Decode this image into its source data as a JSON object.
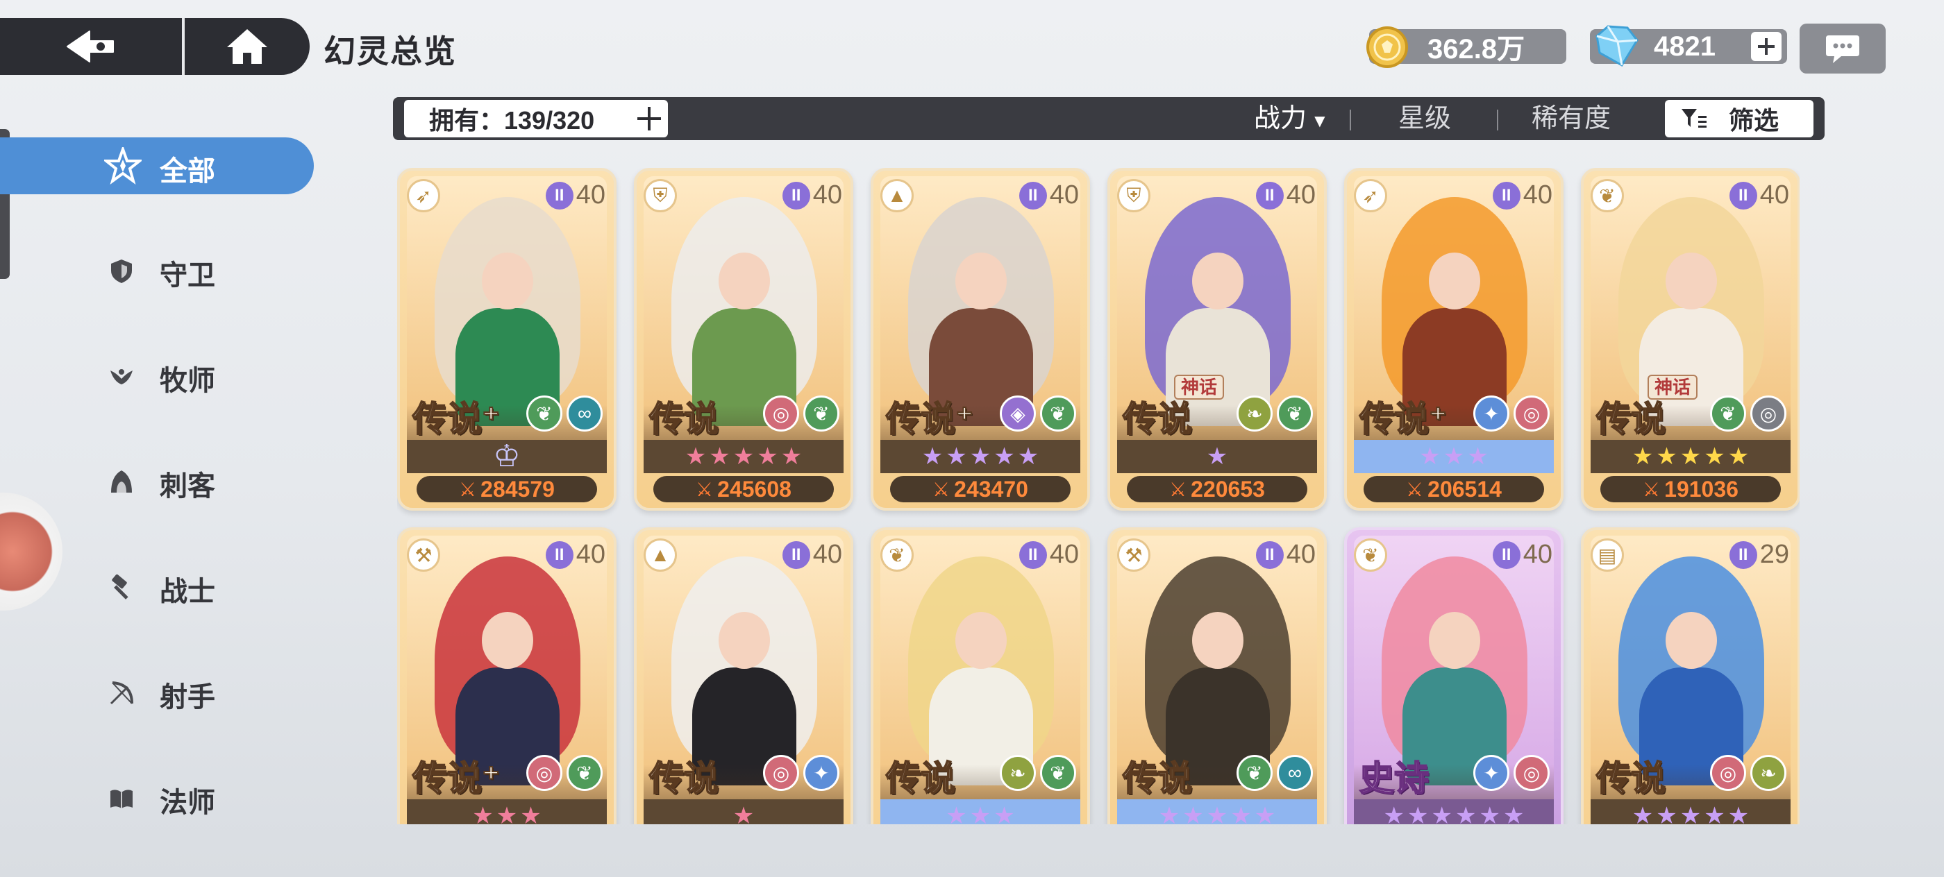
{
  "header": {
    "title": "幻灵总览",
    "gold": "362.8万",
    "gems": "4821"
  },
  "filter": {
    "owned_label": "拥有：139/320",
    "sort_power": "战力",
    "sort_star": "星级",
    "sort_rarity": "稀有度",
    "filter_label": "筛选"
  },
  "sidebar": {
    "items": [
      {
        "label": "全部",
        "icon": "all-star-icon"
      },
      {
        "label": "守卫",
        "icon": "shield-icon"
      },
      {
        "label": "牧师",
        "icon": "wing-icon"
      },
      {
        "label": "刺客",
        "icon": "hood-icon"
      },
      {
        "label": "战士",
        "icon": "hammer-icon"
      },
      {
        "label": "射手",
        "icon": "bow-icon"
      },
      {
        "label": "法师",
        "icon": "book-icon"
      }
    ]
  },
  "cards": [
    {
      "rarity": "传说",
      "plus": true,
      "myth": "",
      "level": "40",
      "class": "bow",
      "elements": [
        "green",
        "teal"
      ],
      "stars": "crown",
      "starcolor": "",
      "band": "dark",
      "power": "284579",
      "hair": "#e8dccd",
      "body": "#2d8a53"
    },
    {
      "rarity": "传说",
      "plus": false,
      "myth": "",
      "level": "40",
      "class": "shield",
      "elements": [
        "pink",
        "green"
      ],
      "stars": 5,
      "starcolor": "pink",
      "band": "dark",
      "power": "245608",
      "hair": "#ececec",
      "body": "#6c9a4f"
    },
    {
      "rarity": "传说",
      "plus": true,
      "myth": "",
      "level": "40",
      "class": "hood",
      "elements": [
        "purple",
        "green"
      ],
      "stars": 5,
      "starcolor": "purple",
      "band": "dark",
      "power": "243470",
      "hair": "#d9d4cf",
      "body": "#7a4b3a"
    },
    {
      "rarity": "传说",
      "plus": false,
      "myth": "神话",
      "level": "40",
      "class": "shield",
      "elements": [
        "olive",
        "green"
      ],
      "stars": 1,
      "starcolor": "purple",
      "band": "dark",
      "power": "220653",
      "hair": "#7b6ad0",
      "body": "#e9e3d7"
    },
    {
      "rarity": "传说",
      "plus": true,
      "myth": "",
      "level": "40",
      "class": "bow",
      "elements": [
        "blue",
        "pink"
      ],
      "stars": 3,
      "starcolor": "purple",
      "band": "blue",
      "power": "206514",
      "hair": "#f39a2b",
      "body": "#8c3b24"
    },
    {
      "rarity": "传说",
      "plus": false,
      "myth": "神话",
      "level": "40",
      "class": "wing",
      "elements": [
        "green",
        "gray"
      ],
      "stars": 5,
      "starcolor": "gold",
      "band": "dark",
      "power": "191036",
      "hair": "#f2d69a",
      "body": "#f3ece2"
    },
    {
      "rarity": "传说",
      "plus": true,
      "myth": "",
      "level": "40",
      "class": "hammer",
      "elements": [
        "pink",
        "green"
      ],
      "stars": 3,
      "starcolor": "pink",
      "band": "dark",
      "power": "",
      "hair": "#c9343c",
      "body": "#2c2f4d"
    },
    {
      "rarity": "传说",
      "plus": false,
      "myth": "",
      "level": "40",
      "class": "hood",
      "elements": [
        "pink",
        "blue"
      ],
      "stars": 1,
      "starcolor": "pink",
      "band": "dark",
      "power": "",
      "hair": "#eeeeee",
      "body": "#252428"
    },
    {
      "rarity": "传说",
      "plus": false,
      "myth": "",
      "level": "40",
      "class": "wing",
      "elements": [
        "olive",
        "green"
      ],
      "stars": 3,
      "starcolor": "purple",
      "band": "blue",
      "power": "",
      "hair": "#f0d68a",
      "body": "#f2efe6"
    },
    {
      "rarity": "传说",
      "plus": false,
      "myth": "",
      "level": "40",
      "class": "hammer",
      "elements": [
        "green",
        "teal"
      ],
      "stars": 5,
      "starcolor": "purple",
      "band": "blue",
      "power": "",
      "hair": "#4c4030",
      "body": "#3b332a"
    },
    {
      "rarity": "史诗",
      "plus": false,
      "myth": "",
      "level": "40",
      "class": "wing",
      "elements": [
        "blue",
        "pink"
      ],
      "stars": 6,
      "starcolor": "purple",
      "band": "purple",
      "power": "",
      "hair": "#f08aa0",
      "body": "#3d8e8c",
      "epic": true
    },
    {
      "rarity": "传说",
      "plus": false,
      "myth": "",
      "level": "29",
      "class": "book",
      "elements": [
        "pink",
        "olive"
      ],
      "stars": 5,
      "starcolor": "purple",
      "band": "dark",
      "power": "",
      "hair": "#4b8fe0",
      "body": "#2f62b8"
    }
  ]
}
